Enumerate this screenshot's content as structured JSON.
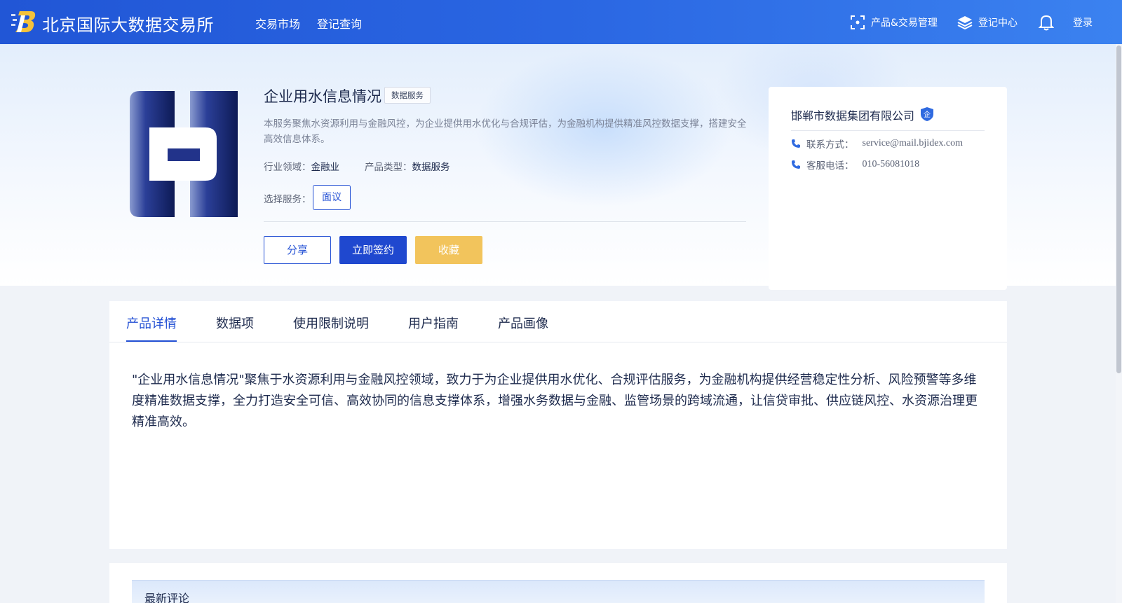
{
  "header": {
    "brand": "北京国际大数据交易所",
    "nav": [
      "交易市场",
      "登记查询"
    ],
    "product_mgmt": "产品&交易管理",
    "register_center": "登记中心",
    "login": "登录"
  },
  "product": {
    "title": "企业用水信息情况",
    "tag": "数据服务",
    "description": "本服务聚焦水资源利用与金融风控，为企业提供用水优化与合规评估，为金融机构提供精准风控数据支撑，搭建安全高效信息体系。",
    "industry_label": "行业领域：",
    "industry_value": "金融业",
    "type_label": "产品类型：",
    "type_value": "数据服务",
    "service_label": "选择服务：",
    "service_option": "面议",
    "buttons": {
      "share": "分享",
      "sign": "立即签约",
      "favorite": "收藏"
    }
  },
  "company": {
    "name": "邯郸市数据集团有限公司",
    "badge": "企",
    "contact_label": "联系方式：",
    "contact_value": "service@mail.bjidex.com",
    "phone_label": "客服电话：",
    "phone_value": "010-56081018"
  },
  "tabs": [
    "产品详情",
    "数据项",
    "使用限制说明",
    "用户指南",
    "产品画像"
  ],
  "active_tab": "产品详情",
  "detail_text": "\"企业用水信息情况\"聚焦于水资源利用与金融风控领域，致力于为企业提供用水优化、合规评估服务，为金融机构提供经营稳定性分析、风险预警等多维度精准数据支撑，全力打造安全可信、高效协同的信息支撑体系，增强水务数据与金融、监管场景的跨域流通，让信贷审批、供应链风控、水资源治理更精准高效。",
  "comments": {
    "title": "最新评论"
  },
  "colors": {
    "primary": "#2350d4",
    "header": "#2a66e2",
    "favorite": "#f2c45c"
  }
}
